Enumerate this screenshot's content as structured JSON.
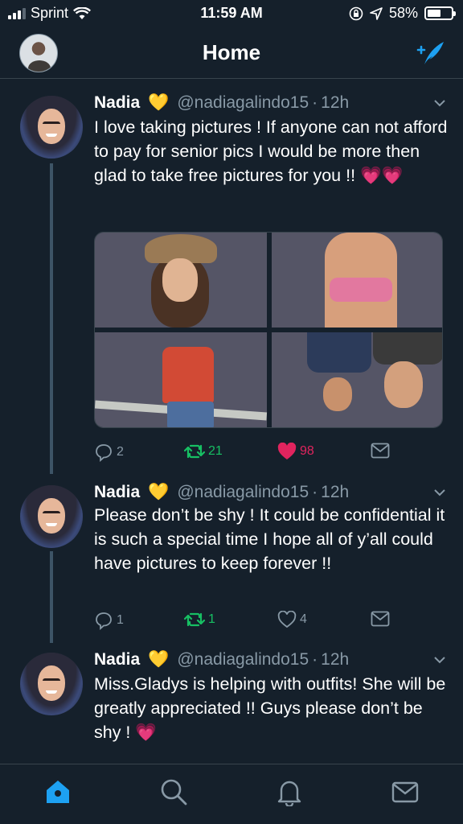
{
  "status_bar": {
    "carrier": "Sprint",
    "time": "11:59 AM",
    "battery_percent": "58%",
    "battery_level": 0.58
  },
  "header": {
    "title": "Home"
  },
  "tweets": [
    {
      "name": "Nadia",
      "emoji": "💛",
      "handle": "@nadiagalindo15",
      "dot": "·",
      "time": "12h",
      "text": "I love taking pictures ! If anyone can not afford to pay for senior pics I would be more then glad to take free pictures for you !! 💗💗",
      "replies": "2",
      "retweets": "21",
      "likes": "98"
    },
    {
      "name": "Nadia",
      "emoji": "💛",
      "handle": "@nadiagalindo15",
      "dot": "·",
      "time": "12h",
      "text": "Please don’t be shy ! It could be confidential it is such a special time I hope all of y’all could have pictures to keep forever !!",
      "replies": "1",
      "retweets": "1",
      "likes": "4"
    },
    {
      "name": "Nadia",
      "emoji": "💛",
      "handle": "@nadiagalindo15",
      "dot": "·",
      "time": "12h",
      "text": "Miss.Gladys is helping with outfits! She will be greatly appreciated !! Guys please don’t be shy ! 💗"
    }
  ],
  "colors": {
    "background": "#15202b",
    "accent": "#1da1f2",
    "retweet": "#17bf63",
    "like": "#e0245e",
    "muted": "#8899a6"
  },
  "icons": {
    "compose": "compose-tweet-icon",
    "tabs": [
      "home-icon",
      "search-icon",
      "notifications-icon",
      "messages-icon"
    ]
  }
}
